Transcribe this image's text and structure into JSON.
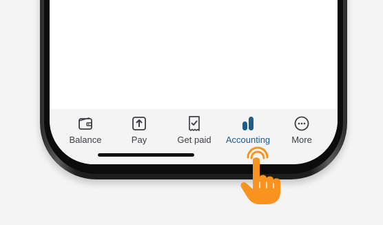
{
  "colors": {
    "active_tab": "#1f5c86",
    "inactive_tab": "#3c3f44",
    "tab_bar_bg": "#f4f4f4",
    "hand": "#f7931e"
  },
  "tab_bar": {
    "active": "Accounting",
    "items": [
      {
        "label": "Balance",
        "icon": "wallet-icon"
      },
      {
        "label": "Pay",
        "icon": "upload-arrow-icon"
      },
      {
        "label": "Get paid",
        "icon": "receipt-check-icon"
      },
      {
        "label": "Accounting",
        "icon": "bar-chart-icon"
      },
      {
        "label": "More",
        "icon": "more-dots-icon"
      }
    ]
  },
  "pointer": {
    "icon": "tap-hand-icon"
  }
}
